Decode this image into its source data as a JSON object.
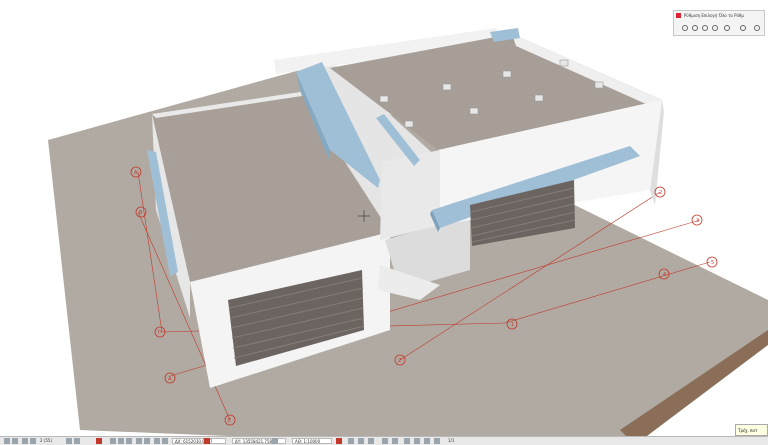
{
  "minipanel": {
    "title": "Ρύθμιση Επιλογή Όλο το Ρύθμ",
    "tooltip": "Τρέχ. πατ"
  },
  "statusbar": {
    "zoom": "2 (55)",
    "coord_x": "ΔΧ: 6152030.9077",
    "coord_y": "ΔΥ: 13558421.7581",
    "angle": "ΑΘ: 1:10000",
    "page": "1/1"
  },
  "grid_markers": [
    {
      "label": "Α"
    },
    {
      "label": "Β"
    },
    {
      "label": "Γ"
    },
    {
      "label": "Δ"
    },
    {
      "label": "Ε"
    },
    {
      "label": "Ζ"
    },
    {
      "label": "1"
    },
    {
      "label": "2"
    },
    {
      "label": "3"
    },
    {
      "label": "4"
    },
    {
      "label": "5"
    }
  ],
  "colors": {
    "ground": "#b5aea6",
    "wall": "#f3f3f3",
    "roof": "#a69e97",
    "accent": "#9fbfd6",
    "grid": "#c0392b",
    "shutter": "#6b6461"
  }
}
